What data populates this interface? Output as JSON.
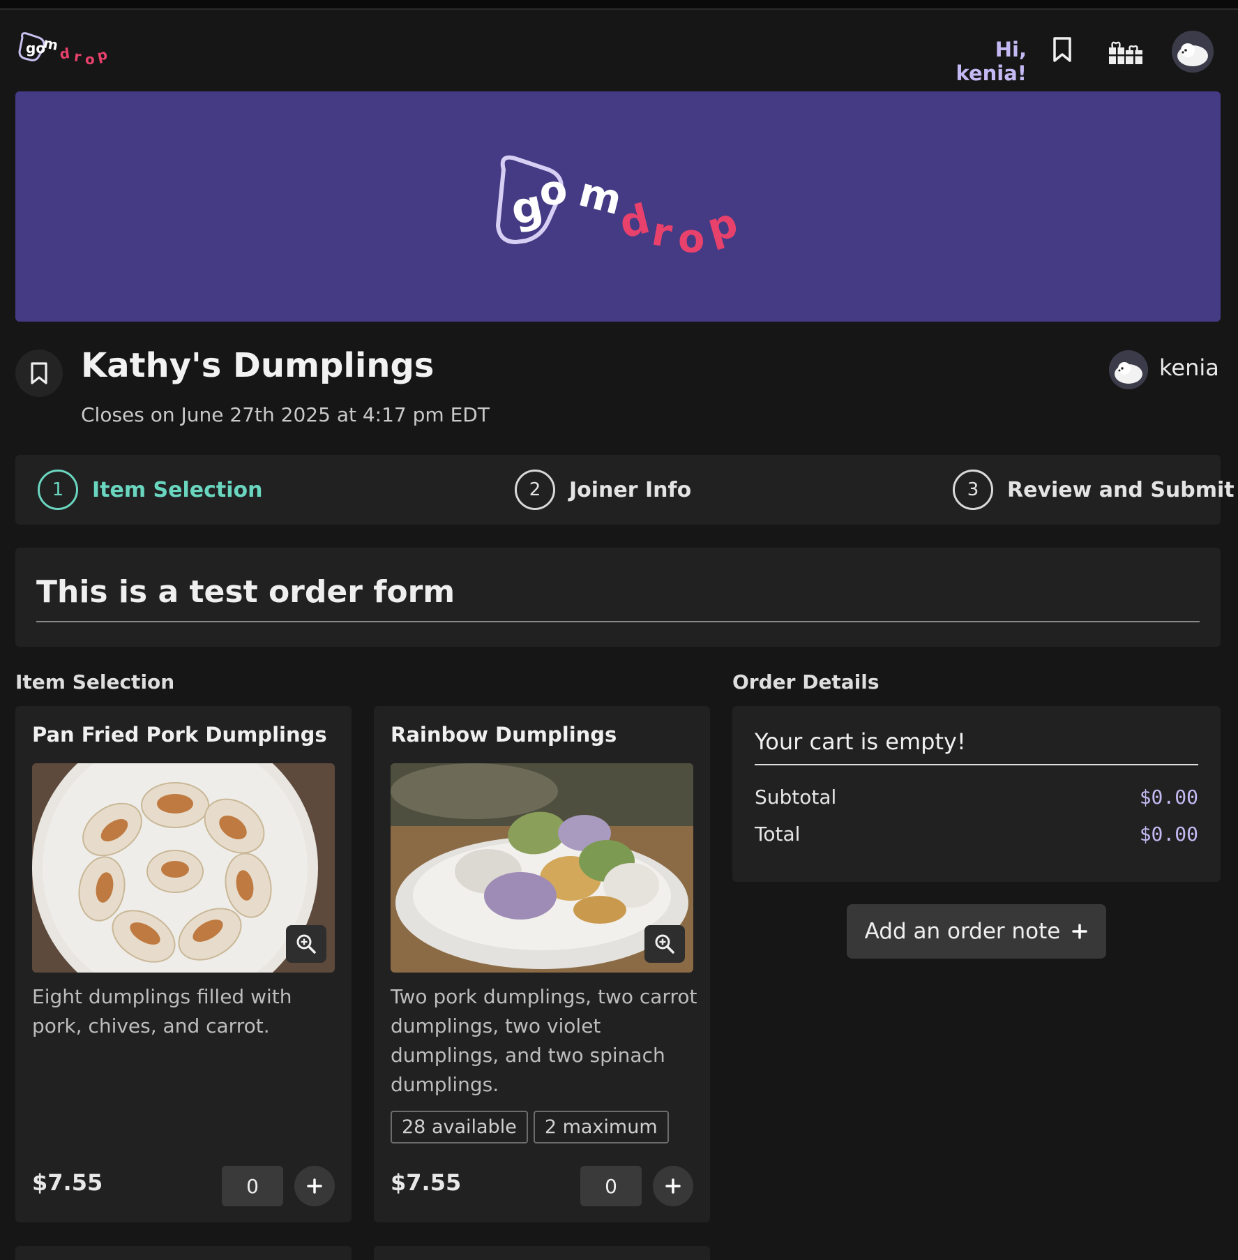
{
  "header": {
    "greeting": "Hi, kenia!",
    "logo_text": "gomdrop"
  },
  "banner": {
    "logo_text": "gomdrop"
  },
  "shop": {
    "title": "Kathy's Dumplings",
    "closes": "Closes on June 27th 2025 at 4:17 pm EDT",
    "owner": "kenia"
  },
  "steps": [
    {
      "num": "1",
      "label": "Item Selection",
      "active": true
    },
    {
      "num": "2",
      "label": "Joiner Info",
      "active": false
    },
    {
      "num": "3",
      "label": "Review and Submit",
      "active": false
    }
  ],
  "form_title": "This is a test order form",
  "sections": {
    "items": "Item Selection",
    "order": "Order Details"
  },
  "items": [
    {
      "name": "Pan Fried Pork Dumplings",
      "description": "Eight dumplings filled with pork, chives, and carrot.",
      "badges": [],
      "price": "$7.55",
      "quantity": "0"
    },
    {
      "name": "Rainbow Dumplings",
      "description": "Two pork dumplings, two carrot dumplings, two violet dumplings, and two spinach dumplings.",
      "badges": [
        "28 available",
        "2 maximum"
      ],
      "price": "$7.55",
      "quantity": "0"
    }
  ],
  "order": {
    "empty_message": "Your cart is empty!",
    "subtotal_label": "Subtotal",
    "subtotal_value": "$0.00",
    "total_label": "Total",
    "total_value": "$0.00",
    "note_button": "Add an order note"
  },
  "colors": {
    "background": "#161616",
    "panel": "#212121",
    "banner": "#453b85",
    "accent": "#6ad6c0",
    "greeting": "#c4b9f2",
    "brand_pink": "#e8416b"
  },
  "icons": {
    "bookmark": "bookmark-icon",
    "gift": "gifts-icon",
    "zoom": "zoom-in-icon",
    "plus": "plus-icon"
  }
}
